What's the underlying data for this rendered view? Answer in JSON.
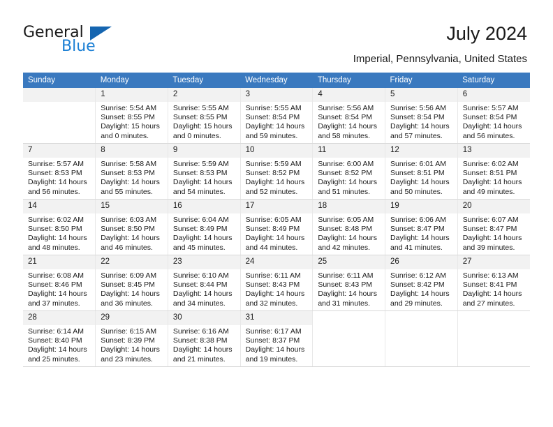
{
  "brand": {
    "name_part1": "General",
    "name_part2": "Blue",
    "triangle_icon": "triangle-icon",
    "accent_color": "#1b7fd4",
    "triangle_color": "#1565b0"
  },
  "header": {
    "title": "July 2024",
    "subtitle": "Imperial, Pennsylvania, United States"
  },
  "calendar": {
    "header_bg": "#3a79bf",
    "header_text_color": "#ffffff",
    "daynum_bg": "#f2f2f2",
    "weekdays": [
      "Sunday",
      "Monday",
      "Tuesday",
      "Wednesday",
      "Thursday",
      "Friday",
      "Saturday"
    ],
    "labels": {
      "sunrise": "Sunrise:",
      "sunset": "Sunset:",
      "daylight": "Daylight:"
    },
    "weeks": [
      [
        {
          "day": "",
          "empty": true
        },
        {
          "day": "1",
          "sunrise": "Sunrise: 5:54 AM",
          "sunset": "Sunset: 8:55 PM",
          "daylight": "Daylight: 15 hours and 0 minutes."
        },
        {
          "day": "2",
          "sunrise": "Sunrise: 5:55 AM",
          "sunset": "Sunset: 8:55 PM",
          "daylight": "Daylight: 15 hours and 0 minutes."
        },
        {
          "day": "3",
          "sunrise": "Sunrise: 5:55 AM",
          "sunset": "Sunset: 8:54 PM",
          "daylight": "Daylight: 14 hours and 59 minutes."
        },
        {
          "day": "4",
          "sunrise": "Sunrise: 5:56 AM",
          "sunset": "Sunset: 8:54 PM",
          "daylight": "Daylight: 14 hours and 58 minutes."
        },
        {
          "day": "5",
          "sunrise": "Sunrise: 5:56 AM",
          "sunset": "Sunset: 8:54 PM",
          "daylight": "Daylight: 14 hours and 57 minutes."
        },
        {
          "day": "6",
          "sunrise": "Sunrise: 5:57 AM",
          "sunset": "Sunset: 8:54 PM",
          "daylight": "Daylight: 14 hours and 56 minutes."
        }
      ],
      [
        {
          "day": "7",
          "sunrise": "Sunrise: 5:57 AM",
          "sunset": "Sunset: 8:53 PM",
          "daylight": "Daylight: 14 hours and 56 minutes."
        },
        {
          "day": "8",
          "sunrise": "Sunrise: 5:58 AM",
          "sunset": "Sunset: 8:53 PM",
          "daylight": "Daylight: 14 hours and 55 minutes."
        },
        {
          "day": "9",
          "sunrise": "Sunrise: 5:59 AM",
          "sunset": "Sunset: 8:53 PM",
          "daylight": "Daylight: 14 hours and 54 minutes."
        },
        {
          "day": "10",
          "sunrise": "Sunrise: 5:59 AM",
          "sunset": "Sunset: 8:52 PM",
          "daylight": "Daylight: 14 hours and 52 minutes."
        },
        {
          "day": "11",
          "sunrise": "Sunrise: 6:00 AM",
          "sunset": "Sunset: 8:52 PM",
          "daylight": "Daylight: 14 hours and 51 minutes."
        },
        {
          "day": "12",
          "sunrise": "Sunrise: 6:01 AM",
          "sunset": "Sunset: 8:51 PM",
          "daylight": "Daylight: 14 hours and 50 minutes."
        },
        {
          "day": "13",
          "sunrise": "Sunrise: 6:02 AM",
          "sunset": "Sunset: 8:51 PM",
          "daylight": "Daylight: 14 hours and 49 minutes."
        }
      ],
      [
        {
          "day": "14",
          "sunrise": "Sunrise: 6:02 AM",
          "sunset": "Sunset: 8:50 PM",
          "daylight": "Daylight: 14 hours and 48 minutes."
        },
        {
          "day": "15",
          "sunrise": "Sunrise: 6:03 AM",
          "sunset": "Sunset: 8:50 PM",
          "daylight": "Daylight: 14 hours and 46 minutes."
        },
        {
          "day": "16",
          "sunrise": "Sunrise: 6:04 AM",
          "sunset": "Sunset: 8:49 PM",
          "daylight": "Daylight: 14 hours and 45 minutes."
        },
        {
          "day": "17",
          "sunrise": "Sunrise: 6:05 AM",
          "sunset": "Sunset: 8:49 PM",
          "daylight": "Daylight: 14 hours and 44 minutes."
        },
        {
          "day": "18",
          "sunrise": "Sunrise: 6:05 AM",
          "sunset": "Sunset: 8:48 PM",
          "daylight": "Daylight: 14 hours and 42 minutes."
        },
        {
          "day": "19",
          "sunrise": "Sunrise: 6:06 AM",
          "sunset": "Sunset: 8:47 PM",
          "daylight": "Daylight: 14 hours and 41 minutes."
        },
        {
          "day": "20",
          "sunrise": "Sunrise: 6:07 AM",
          "sunset": "Sunset: 8:47 PM",
          "daylight": "Daylight: 14 hours and 39 minutes."
        }
      ],
      [
        {
          "day": "21",
          "sunrise": "Sunrise: 6:08 AM",
          "sunset": "Sunset: 8:46 PM",
          "daylight": "Daylight: 14 hours and 37 minutes."
        },
        {
          "day": "22",
          "sunrise": "Sunrise: 6:09 AM",
          "sunset": "Sunset: 8:45 PM",
          "daylight": "Daylight: 14 hours and 36 minutes."
        },
        {
          "day": "23",
          "sunrise": "Sunrise: 6:10 AM",
          "sunset": "Sunset: 8:44 PM",
          "daylight": "Daylight: 14 hours and 34 minutes."
        },
        {
          "day": "24",
          "sunrise": "Sunrise: 6:11 AM",
          "sunset": "Sunset: 8:43 PM",
          "daylight": "Daylight: 14 hours and 32 minutes."
        },
        {
          "day": "25",
          "sunrise": "Sunrise: 6:11 AM",
          "sunset": "Sunset: 8:43 PM",
          "daylight": "Daylight: 14 hours and 31 minutes."
        },
        {
          "day": "26",
          "sunrise": "Sunrise: 6:12 AM",
          "sunset": "Sunset: 8:42 PM",
          "daylight": "Daylight: 14 hours and 29 minutes."
        },
        {
          "day": "27",
          "sunrise": "Sunrise: 6:13 AM",
          "sunset": "Sunset: 8:41 PM",
          "daylight": "Daylight: 14 hours and 27 minutes."
        }
      ],
      [
        {
          "day": "28",
          "sunrise": "Sunrise: 6:14 AM",
          "sunset": "Sunset: 8:40 PM",
          "daylight": "Daylight: 14 hours and 25 minutes."
        },
        {
          "day": "29",
          "sunrise": "Sunrise: 6:15 AM",
          "sunset": "Sunset: 8:39 PM",
          "daylight": "Daylight: 14 hours and 23 minutes."
        },
        {
          "day": "30",
          "sunrise": "Sunrise: 6:16 AM",
          "sunset": "Sunset: 8:38 PM",
          "daylight": "Daylight: 14 hours and 21 minutes."
        },
        {
          "day": "31",
          "sunrise": "Sunrise: 6:17 AM",
          "sunset": "Sunset: 8:37 PM",
          "daylight": "Daylight: 14 hours and 19 minutes."
        },
        {
          "day": "",
          "empty": true,
          "blank": true
        },
        {
          "day": "",
          "empty": true,
          "blank": true
        },
        {
          "day": "",
          "empty": true,
          "blank": true
        }
      ]
    ]
  }
}
